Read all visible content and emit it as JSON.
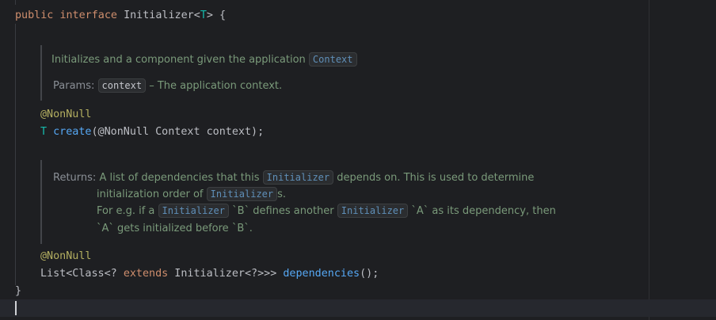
{
  "code": {
    "line1": {
      "public": "public",
      "interface": "interface",
      "name": "Initializer",
      "lt": "<",
      "typeParam": "T",
      "gtBrace": "> {"
    },
    "create": {
      "annotation": "@NonNull",
      "returnType": "T",
      "method": "create",
      "params": "(@NonNull Context context);"
    },
    "dependencies": {
      "annotation": "@NonNull",
      "prefix": "List<Class<? ",
      "extends": "extends",
      "middle": " Initializer<?>>> ",
      "method": "dependencies",
      "suffix": "();"
    },
    "closingBrace": "}"
  },
  "doc1": {
    "text": "Initializes and a component given the application",
    "contextRef": "Context",
    "paramsLabel": "Params:",
    "paramName": "context",
    "paramDesc": "– The application context."
  },
  "doc2": {
    "returnsLabel": "Returns:",
    "l1a": "A list of dependencies that this",
    "l1ref": "Initializer",
    "l1b": "depends on. This is used to determine",
    "l2a": "initialization order of",
    "l2ref": "Initializer",
    "l2b": "s.",
    "l3a": "For e.g. if a",
    "l3ref1": "Initializer",
    "l3b": "`B` defines another",
    "l3ref2": "Initializer",
    "l3c": "`A` as its dependency, then",
    "l4": "`A` gets initialized before `B`."
  }
}
